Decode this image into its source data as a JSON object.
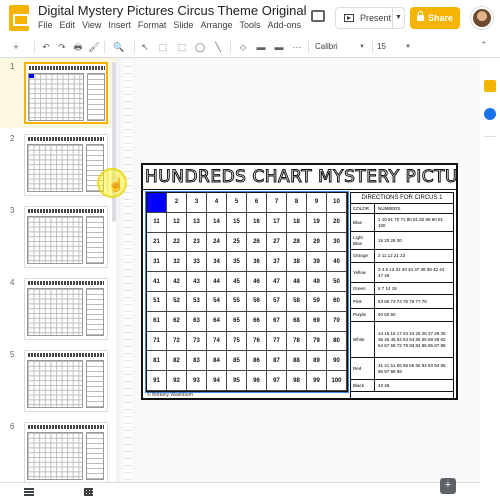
{
  "app": {
    "title": "Digital Mystery Pictures Circus Theme Original",
    "menu": [
      "File",
      "Edit",
      "View",
      "Insert",
      "Format",
      "Slide",
      "Arrange",
      "Tools",
      "Add-ons"
    ],
    "present_label": "Present",
    "share_label": "Share",
    "accent_color": "#f4b400"
  },
  "toolbar": {
    "font": "Calibri",
    "font_size": "15",
    "buttons": [
      "+",
      "↶",
      "↷",
      "🖶",
      "🖌",
      "🔍",
      "↖",
      "⬚",
      "◯",
      "╲",
      "⬦",
      "▬",
      "⋯"
    ]
  },
  "filmstrip": {
    "slides": [
      {
        "num": "1",
        "active": true
      },
      {
        "num": "2",
        "active": false
      },
      {
        "num": "3",
        "active": false
      },
      {
        "num": "4",
        "active": false
      },
      {
        "num": "5",
        "active": false
      },
      {
        "num": "6",
        "active": false
      }
    ]
  },
  "slide": {
    "title": "HUNDREDS CHART MYSTERY PICTURES",
    "highlighted_cell": 1,
    "highlight_color": "#0000ff",
    "credit": "© Brittany Washburn",
    "directions": {
      "title": "DIRECTIONS FOR CIRCUS 1",
      "color_header": "COLOR",
      "numbers_header": "NUMBERS",
      "rows": [
        {
          "color": "Blue",
          "numbers": "1 10 61 70 71 80 81 82 89 90 91 100"
        },
        {
          "color": "Light Blue",
          "numbers": "19 20 29 30"
        },
        {
          "color": "Orange",
          "numbers": "2 11 12 21 22"
        },
        {
          "color": "Yellow",
          "numbers": "3 4 5 13 32 33 34 37 38 39 42 44 47 49"
        },
        {
          "color": "Green",
          "numbers": "6 7 14 15"
        },
        {
          "color": "Pink",
          "numbers": "53 66 73 74 75 76 77 78"
        },
        {
          "color": "Purple",
          "numbers": "40 50 60"
        },
        {
          "color": "White",
          "numbers": "14 15 16 17 23 24 25 26 27 28 35 36 45 46 52 53 54 55 56 58 59 62 64 67 69 72 79 83 84 85 86 87 88"
        },
        {
          "color": "Red",
          "numbers": "31 41 51 55 56 65 66 92 93 94 95 96 97 98 99"
        },
        {
          "color": "Black",
          "numbers": "43 48"
        }
      ]
    }
  }
}
